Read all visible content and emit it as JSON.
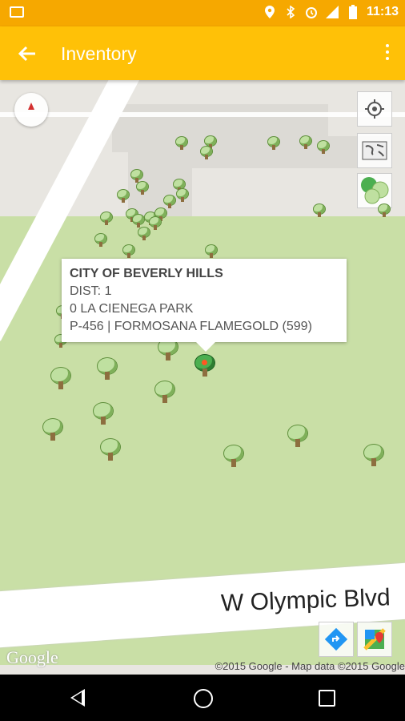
{
  "status_bar": {
    "time": "11:13"
  },
  "app_bar": {
    "title": "Inventory"
  },
  "map": {
    "street_name": "W Olympic Blvd",
    "logo": "Google",
    "copyright": "©2015 Google - Map data ©2015 Google"
  },
  "info_window": {
    "title": "CITY OF BEVERLY HILLS",
    "line1": "DIST: 1",
    "line2": "0 LA CIENEGA PARK",
    "line3": "P-456 | FORMOSANA FLAMEGOLD (599)"
  },
  "icons": {
    "status": [
      "image-icon",
      "location-pin-icon",
      "bluetooth-icon",
      "alarm-icon",
      "lte-signal-icon",
      "battery-icon"
    ],
    "app_bar": [
      "back-arrow-icon",
      "overflow-menu-icon"
    ],
    "map_controls": [
      "compass-icon",
      "my-location-icon",
      "world-map-icon",
      "tree-layer-icon",
      "directions-icon",
      "google-maps-icon"
    ],
    "nav": [
      "nav-back-icon",
      "nav-home-icon",
      "nav-recents-icon"
    ]
  },
  "colors": {
    "status_bar": "#f6a800",
    "app_bar": "#ffc107",
    "park": "#c9dfa6"
  }
}
